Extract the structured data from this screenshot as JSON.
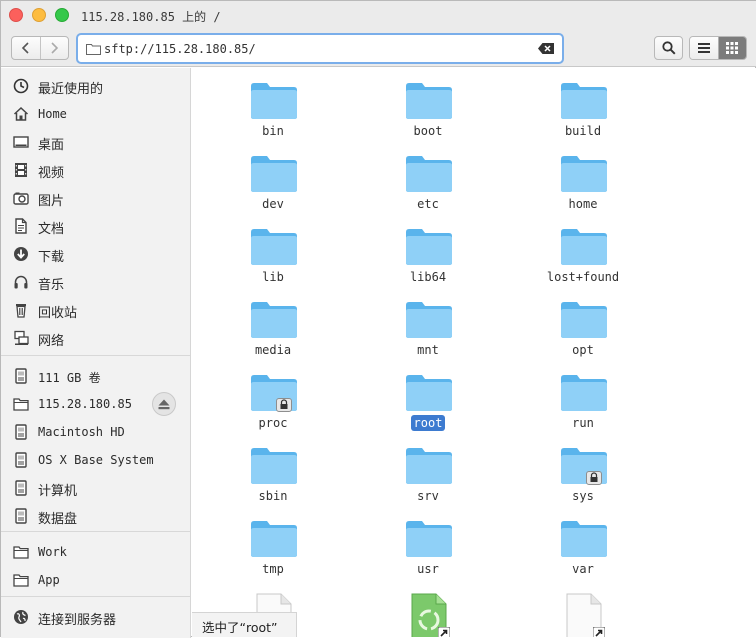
{
  "window": {
    "title": "115.28.180.85 上的 /"
  },
  "toolbar": {
    "address_value": "sftp://115.28.180.85/"
  },
  "sidebar": {
    "items": [
      {
        "label": "最近使用的",
        "icon": "clock-icon",
        "cjk": true
      },
      {
        "label": "Home",
        "icon": "home-icon",
        "cjk": false
      },
      {
        "label": "桌面",
        "icon": "desktop-icon",
        "cjk": true
      },
      {
        "label": "视频",
        "icon": "film-icon",
        "cjk": true
      },
      {
        "label": "图片",
        "icon": "camera-icon",
        "cjk": true
      },
      {
        "label": "文档",
        "icon": "document-icon",
        "cjk": true
      },
      {
        "label": "下载",
        "icon": "download-icon",
        "cjk": true
      },
      {
        "label": "音乐",
        "icon": "headphones-icon",
        "cjk": true
      },
      {
        "label": "回收站",
        "icon": "trash-icon",
        "cjk": true
      },
      {
        "label": "网络",
        "icon": "network-icon",
        "cjk": true
      },
      {
        "label": "111 GB 卷",
        "icon": "drive-icon",
        "cjk": false
      },
      {
        "label": "115.28.180.85",
        "icon": "folder-icon",
        "cjk": false
      },
      {
        "label": "Macintosh HD",
        "icon": "drive-icon",
        "cjk": false
      },
      {
        "label": "OS X Base System",
        "icon": "drive-icon",
        "cjk": false
      },
      {
        "label": "计算机",
        "icon": "drive-icon",
        "cjk": true
      },
      {
        "label": "数据盘",
        "icon": "drive-icon",
        "cjk": true
      },
      {
        "label": "Work",
        "icon": "folder-icon",
        "cjk": false
      },
      {
        "label": "App",
        "icon": "folder-icon",
        "cjk": false
      },
      {
        "label": "连接到服务器",
        "icon": "globe-icon",
        "cjk": true
      }
    ]
  },
  "files": [
    {
      "name": "bin",
      "type": "folder",
      "locked": false,
      "selected": false
    },
    {
      "name": "boot",
      "type": "folder",
      "locked": false,
      "selected": false
    },
    {
      "name": "build",
      "type": "folder",
      "locked": false,
      "selected": false
    },
    {
      "name": "dev",
      "type": "folder",
      "locked": false,
      "selected": false
    },
    {
      "name": "etc",
      "type": "folder",
      "locked": false,
      "selected": false
    },
    {
      "name": "home",
      "type": "folder",
      "locked": false,
      "selected": false
    },
    {
      "name": "lib",
      "type": "folder",
      "locked": false,
      "selected": false
    },
    {
      "name": "lib64",
      "type": "folder",
      "locked": false,
      "selected": false
    },
    {
      "name": "lost+found",
      "type": "folder",
      "locked": false,
      "selected": false
    },
    {
      "name": "media",
      "type": "folder",
      "locked": false,
      "selected": false
    },
    {
      "name": "mnt",
      "type": "folder",
      "locked": false,
      "selected": false
    },
    {
      "name": "opt",
      "type": "folder",
      "locked": false,
      "selected": false
    },
    {
      "name": "proc",
      "type": "folder",
      "locked": true,
      "selected": false
    },
    {
      "name": "root",
      "type": "folder",
      "locked": false,
      "selected": true
    },
    {
      "name": "run",
      "type": "folder",
      "locked": false,
      "selected": false
    },
    {
      "name": "sbin",
      "type": "folder",
      "locked": false,
      "selected": false
    },
    {
      "name": "srv",
      "type": "folder",
      "locked": false,
      "selected": false
    },
    {
      "name": "sys",
      "type": "folder",
      "locked": true,
      "selected": false
    },
    {
      "name": "tmp",
      "type": "folder",
      "locked": false,
      "selected": false
    },
    {
      "name": "usr",
      "type": "folder",
      "locked": false,
      "selected": false
    },
    {
      "name": "var",
      "type": "folder",
      "locked": false,
      "selected": false
    },
    {
      "name": "",
      "type": "file",
      "locked": false,
      "selected": false
    },
    {
      "name": "",
      "type": "recycle-file",
      "locked": false,
      "selected": false
    },
    {
      "name": "",
      "type": "file-link",
      "locked": false,
      "selected": false
    }
  ],
  "status": {
    "text": "选中了“root”"
  },
  "colors": {
    "folder_light": "#8fd0f7",
    "folder_dark": "#5ab4ec",
    "selection": "#3d7bd0",
    "address_focus": "#7aaeea"
  }
}
